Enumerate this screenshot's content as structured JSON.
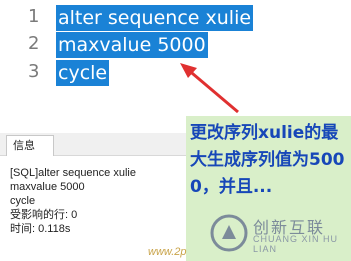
{
  "editor": {
    "line_numbers": [
      "1",
      "2",
      "3"
    ],
    "lines": [
      "alter sequence xulie",
      "maxvalue 5000",
      "cycle"
    ]
  },
  "info_panel": {
    "tab_label": "信息",
    "lines": [
      "[SQL]alter sequence xulie",
      "maxvalue 5000",
      "cycle",
      "受影响的行: 0",
      "时间: 0.118s"
    ]
  },
  "annotation": {
    "text": "更改序列xulie的最大生成序列值为5000，并且..."
  },
  "watermark": {
    "brand_cn": "创新互联",
    "brand_en": "CHUANG XIN HU LIAN",
    "url": "www.2p"
  },
  "colors": {
    "selection": "#1a82d6",
    "annotation_bg": "#d9efc9",
    "annotation_text": "#1747b8",
    "arrow": "#e03030"
  }
}
